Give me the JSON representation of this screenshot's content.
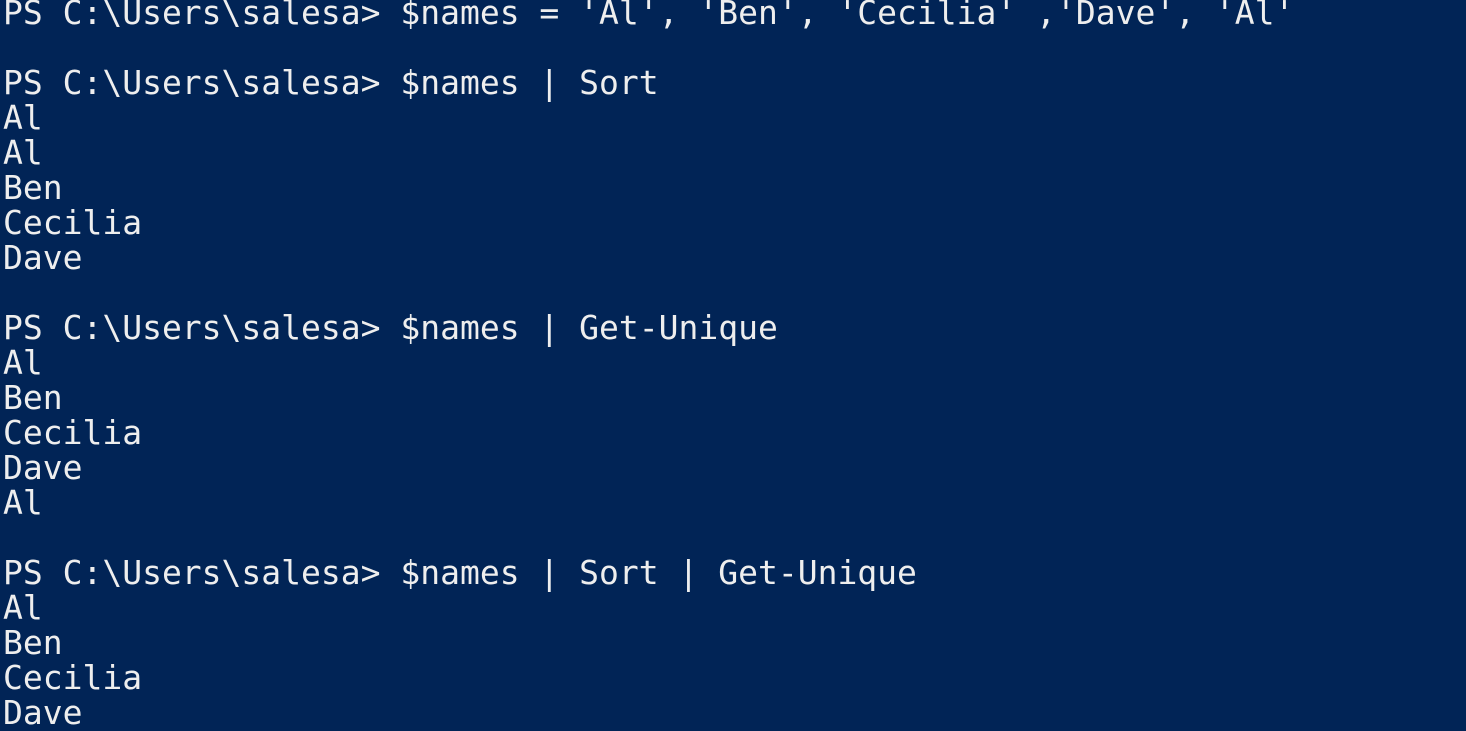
{
  "terminal": {
    "shell": "PowerShell",
    "prompt": "PS C:\\Users\\salesa>",
    "colors": {
      "background": "#012456",
      "foreground": "#eeeeee"
    },
    "lines": [
      {
        "kind": "command",
        "text": "PS C:\\Users\\salesa> $names = 'Al', 'Ben', 'Cecilia' ,'Dave', 'Al'"
      },
      {
        "kind": "blank",
        "text": " "
      },
      {
        "kind": "command",
        "text": "PS C:\\Users\\salesa> $names | Sort"
      },
      {
        "kind": "output",
        "text": "Al"
      },
      {
        "kind": "output",
        "text": "Al"
      },
      {
        "kind": "output",
        "text": "Ben"
      },
      {
        "kind": "output",
        "text": "Cecilia"
      },
      {
        "kind": "output",
        "text": "Dave"
      },
      {
        "kind": "blank",
        "text": " "
      },
      {
        "kind": "command",
        "text": "PS C:\\Users\\salesa> $names | Get-Unique"
      },
      {
        "kind": "output",
        "text": "Al"
      },
      {
        "kind": "output",
        "text": "Ben"
      },
      {
        "kind": "output",
        "text": "Cecilia"
      },
      {
        "kind": "output",
        "text": "Dave"
      },
      {
        "kind": "output",
        "text": "Al"
      },
      {
        "kind": "blank",
        "text": " "
      },
      {
        "kind": "command",
        "text": "PS C:\\Users\\salesa> $names | Sort | Get-Unique"
      },
      {
        "kind": "output",
        "text": "Al"
      },
      {
        "kind": "output",
        "text": "Ben"
      },
      {
        "kind": "output",
        "text": "Cecilia"
      },
      {
        "kind": "output",
        "text": "Dave"
      }
    ]
  }
}
